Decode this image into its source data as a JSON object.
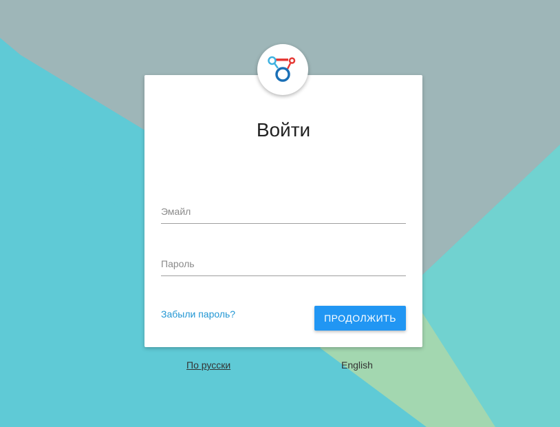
{
  "login": {
    "title": "Войти",
    "email_placeholder": "Эмайл",
    "password_placeholder": "Пароль",
    "forgot_password": "Забыли пароль?",
    "continue_button": "ПРОДОЛЖИТЬ"
  },
  "languages": {
    "russian": "По русски",
    "english": "English"
  },
  "logo": {
    "icon": "connection-nodes-logo-icon"
  },
  "colors": {
    "background_primary": "#5fcad6",
    "background_gray": "#9eb6b8",
    "background_green": "#a3d7b0",
    "background_teal": "#71d2d0",
    "accent": "#2196f3",
    "link": "#2196d3",
    "logo_blue": "#1a6fb6",
    "logo_light_blue": "#3eb1e0",
    "logo_red": "#e53935"
  }
}
